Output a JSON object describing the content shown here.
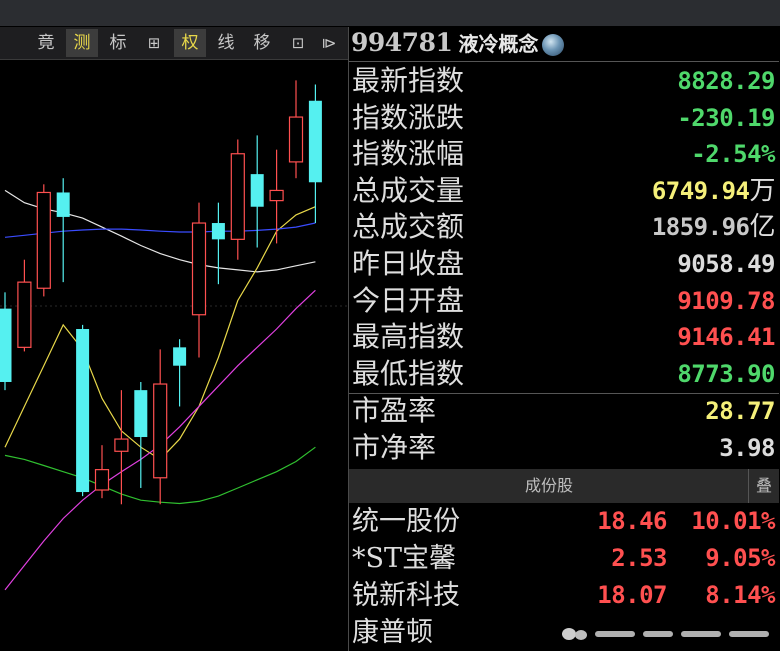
{
  "toolbar": {
    "items": [
      {
        "label": "竟",
        "name": "tool-jing",
        "active": false
      },
      {
        "label": "测",
        "name": "tool-ce",
        "active": true
      },
      {
        "label": "标",
        "name": "tool-biao",
        "active": false
      },
      {
        "label": "⊞",
        "name": "tool-grid",
        "active": false
      },
      {
        "label": "权",
        "name": "tool-quan",
        "active": true
      },
      {
        "label": "线",
        "name": "tool-xian",
        "active": false
      },
      {
        "label": "移",
        "name": "tool-yi",
        "active": false
      },
      {
        "label": "⊡",
        "name": "tool-window",
        "active": false
      },
      {
        "label": "⧐",
        "name": "tool-play",
        "active": false
      }
    ]
  },
  "quote": {
    "code": "994781",
    "name": "液冷概念",
    "rows": [
      {
        "label": "最新指数",
        "value": "8828.29",
        "unit": "",
        "color": "#4fd86b"
      },
      {
        "label": "指数涨跌",
        "value": "-230.19",
        "unit": "",
        "color": "#4fd86b"
      },
      {
        "label": "指数涨幅",
        "value": "-2.54%",
        "unit": "",
        "color": "#4fd86b"
      },
      {
        "label": "总成交量",
        "value": "6749.94",
        "unit": "万",
        "color": "#f5f07a"
      },
      {
        "label": "总成交额",
        "value": "1859.96",
        "unit": "亿",
        "color": "#c8c8c8"
      },
      {
        "label": "昨日收盘",
        "value": "9058.49",
        "unit": "",
        "color": "#dcdcdc"
      },
      {
        "label": "今日开盘",
        "value": "9109.78",
        "unit": "",
        "color": "#ff5050"
      },
      {
        "label": "最高指数",
        "value": "9146.41",
        "unit": "",
        "color": "#ff5050"
      },
      {
        "label": "最低指数",
        "value": "8773.90",
        "unit": "",
        "color": "#4fd86b"
      }
    ],
    "pe": {
      "label": "市盈率",
      "value": "28.77",
      "color": "#f5f07a"
    },
    "pb": {
      "label": "市净率",
      "value": "3.98",
      "color": "#dcdcdc"
    }
  },
  "constituents": {
    "title": "成份股",
    "toggle": "叠",
    "rows": [
      {
        "name": "统一股份",
        "price": "18.46",
        "pct": "10.01%"
      },
      {
        "name": "*ST宝馨",
        "price": "2.53",
        "pct": "9.05%"
      },
      {
        "name": "锐新科技",
        "price": "18.07",
        "pct": "8.14%"
      },
      {
        "name": "康普顿",
        "price": "",
        "pct": ""
      }
    ]
  },
  "colors": {
    "up": "#ff5050",
    "down": "#55f0f0",
    "ma_white": "#e6e6e6",
    "ma_yellow": "#e8d84a",
    "ma_magenta": "#e040e0",
    "ma_green": "#30c030",
    "ma_blue": "#3a4cff"
  },
  "chart_data": {
    "type": "candlestick",
    "candles": [
      {
        "o": 8840,
        "c": 8660,
        "h": 8880,
        "l": 8640,
        "dir": "down"
      },
      {
        "o": 8745,
        "c": 8905,
        "h": 8960,
        "l": 8735,
        "dir": "up"
      },
      {
        "o": 8890,
        "c": 9125,
        "h": 9145,
        "l": 8870,
        "dir": "up"
      },
      {
        "o": 9125,
        "c": 9065,
        "h": 9160,
        "l": 8905,
        "dir": "down"
      },
      {
        "o": 8790,
        "c": 8390,
        "h": 8800,
        "l": 8380,
        "dir": "down"
      },
      {
        "o": 8395,
        "c": 8445,
        "h": 8505,
        "l": 8375,
        "dir": "up"
      },
      {
        "o": 8490,
        "c": 8520,
        "h": 8640,
        "l": 8360,
        "dir": "up"
      },
      {
        "o": 8640,
        "c": 8525,
        "h": 8660,
        "l": 8400,
        "dir": "down"
      },
      {
        "o": 8425,
        "c": 8655,
        "h": 8740,
        "l": 8360,
        "dir": "up"
      },
      {
        "o": 8745,
        "c": 8700,
        "h": 8765,
        "l": 8600,
        "dir": "down"
      },
      {
        "o": 8825,
        "c": 9050,
        "h": 9100,
        "l": 8720,
        "dir": "up"
      },
      {
        "o": 9050,
        "c": 9010,
        "h": 9100,
        "l": 8900,
        "dir": "down"
      },
      {
        "o": 9010,
        "c": 9220,
        "h": 9255,
        "l": 8960,
        "dir": "up"
      },
      {
        "o": 9170,
        "c": 9090,
        "h": 9265,
        "l": 8990,
        "dir": "down"
      },
      {
        "o": 9105,
        "c": 9130,
        "h": 9230,
        "l": 9000,
        "dir": "up"
      },
      {
        "o": 9200,
        "c": 9310,
        "h": 9400,
        "l": 9160,
        "dir": "up"
      },
      {
        "o": 9350,
        "c": 9150,
        "h": 9390,
        "l": 9050,
        "dir": "down"
      }
    ],
    "ma": [
      {
        "color": "ma_white",
        "values": [
          9130,
          9100,
          9085,
          9075,
          9062,
          9040,
          9018,
          8995,
          8975,
          8960,
          8948,
          8940,
          8935,
          8930,
          8935,
          8945,
          8955
        ]
      },
      {
        "color": "ma_yellow",
        "values": [
          8500,
          8600,
          8700,
          8800,
          8740,
          8620,
          8540,
          8500,
          8470,
          8520,
          8600,
          8720,
          8860,
          8940,
          9030,
          9070,
          9090
        ]
      },
      {
        "color": "ma_magenta",
        "values": [
          8150,
          8210,
          8270,
          8325,
          8370,
          8408,
          8440,
          8470,
          8505,
          8550,
          8600,
          8650,
          8700,
          8745,
          8790,
          8840,
          8885
        ]
      },
      {
        "color": "ma_green",
        "values": [
          8480,
          8470,
          8455,
          8440,
          8425,
          8405,
          8385,
          8370,
          8365,
          8362,
          8367,
          8380,
          8400,
          8420,
          8440,
          8465,
          8500
        ]
      },
      {
        "color": "ma_blue",
        "values": [
          9015,
          9020,
          9025,
          9030,
          9033,
          9035,
          9035,
          9033,
          9030,
          9028,
          9028,
          9030,
          9030,
          9032,
          9035,
          9040,
          9050
        ]
      }
    ]
  }
}
